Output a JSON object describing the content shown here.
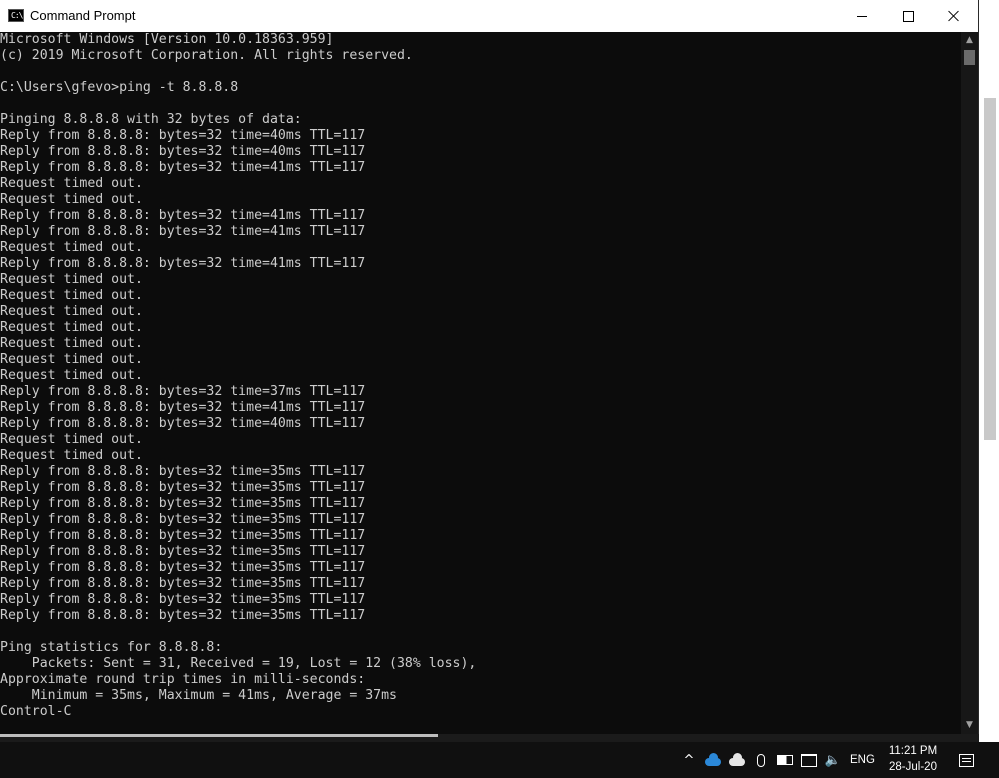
{
  "window": {
    "title": "Command Prompt",
    "icon_text": "C:\\",
    "icon": "cmd-icon"
  },
  "console_lines": [
    "Microsoft Windows [Version 10.0.18363.959]",
    "(c) 2019 Microsoft Corporation. All rights reserved.",
    "",
    "C:\\Users\\gfevo>ping -t 8.8.8.8",
    "",
    "Pinging 8.8.8.8 with 32 bytes of data:",
    "Reply from 8.8.8.8: bytes=32 time=40ms TTL=117",
    "Reply from 8.8.8.8: bytes=32 time=40ms TTL=117",
    "Reply from 8.8.8.8: bytes=32 time=41ms TTL=117",
    "Request timed out.",
    "Request timed out.",
    "Reply from 8.8.8.8: bytes=32 time=41ms TTL=117",
    "Reply from 8.8.8.8: bytes=32 time=41ms TTL=117",
    "Request timed out.",
    "Reply from 8.8.8.8: bytes=32 time=41ms TTL=117",
    "Request timed out.",
    "Request timed out.",
    "Request timed out.",
    "Request timed out.",
    "Request timed out.",
    "Request timed out.",
    "Request timed out.",
    "Reply from 8.8.8.8: bytes=32 time=37ms TTL=117",
    "Reply from 8.8.8.8: bytes=32 time=41ms TTL=117",
    "Reply from 8.8.8.8: bytes=32 time=40ms TTL=117",
    "Request timed out.",
    "Request timed out.",
    "Reply from 8.8.8.8: bytes=32 time=35ms TTL=117",
    "Reply from 8.8.8.8: bytes=32 time=35ms TTL=117",
    "Reply from 8.8.8.8: bytes=32 time=35ms TTL=117",
    "Reply from 8.8.8.8: bytes=32 time=35ms TTL=117",
    "Reply from 8.8.8.8: bytes=32 time=35ms TTL=117",
    "Reply from 8.8.8.8: bytes=32 time=35ms TTL=117",
    "Reply from 8.8.8.8: bytes=32 time=35ms TTL=117",
    "Reply from 8.8.8.8: bytes=32 time=35ms TTL=117",
    "Reply from 8.8.8.8: bytes=32 time=35ms TTL=117",
    "Reply from 8.8.8.8: bytes=32 time=35ms TTL=117",
    "",
    "Ping statistics for 8.8.8.8:",
    "    Packets: Sent = 31, Received = 19, Lost = 12 (38% loss),",
    "Approximate round trip times in milli-seconds:",
    "    Minimum = 35ms, Maximum = 41ms, Average = 37ms",
    "Control-C"
  ],
  "colors": {
    "console_bg": "#0c0c0c",
    "console_text": "#cccccc",
    "titlebar_bg": "#ffffff",
    "taskbar_bg": "#101010",
    "onedrive_blue": "#2b88d8"
  },
  "tray": {
    "icons": [
      "chevron-up-icon",
      "onedrive-icon",
      "cloud-icon",
      "microphone-icon",
      "battery-icon",
      "network-icon",
      "volume-icon",
      "notification-icon"
    ],
    "chevron": "^",
    "volume_glyph": "🔈",
    "language": "ENG",
    "time": "11:21 PM",
    "date": "28-Jul-20"
  }
}
